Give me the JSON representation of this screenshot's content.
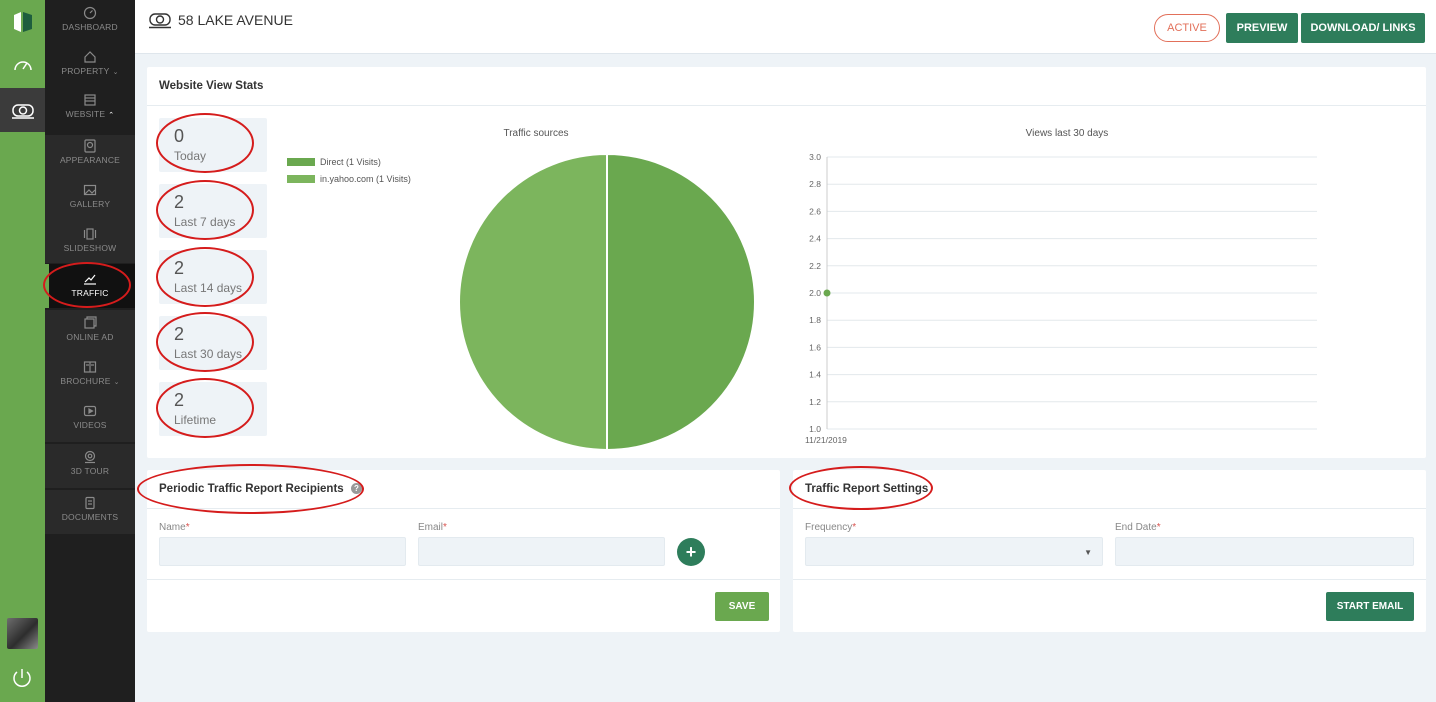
{
  "header": {
    "property_title": "58 LAKE AVENUE",
    "status_label": "ACTIVE",
    "preview_label": "PREVIEW",
    "download_label": "DOWNLOAD/ LINKS"
  },
  "sidebar": {
    "items": [
      {
        "key": "dashboard",
        "label": "DASHBOARD",
        "icon": "dashboard-icon"
      },
      {
        "key": "property",
        "label": "PROPERTY",
        "icon": "home-icon",
        "caret": "⌄"
      },
      {
        "key": "website",
        "label": "WEBSITE",
        "icon": "website-icon",
        "caret": "⌃"
      },
      {
        "key": "appearance",
        "label": "APPEARANCE",
        "icon": "appearance-icon"
      },
      {
        "key": "gallery",
        "label": "GALLERY",
        "icon": "gallery-icon"
      },
      {
        "key": "slideshow",
        "label": "SLIDESHOW",
        "icon": "slideshow-icon"
      },
      {
        "key": "traffic",
        "label": "TRAFFIC",
        "icon": "chart-icon"
      },
      {
        "key": "online_ad",
        "label": "ONLINE AD",
        "icon": "online-ad-icon"
      },
      {
        "key": "brochure",
        "label": "BROCHURE",
        "icon": "brochure-icon",
        "caret": "⌄"
      },
      {
        "key": "videos",
        "label": "VIDEOS",
        "icon": "video-icon"
      },
      {
        "key": "tour",
        "label": "3D TOUR",
        "icon": "tour-icon"
      },
      {
        "key": "documents",
        "label": "DOCUMENTS",
        "icon": "document-icon"
      }
    ]
  },
  "stats_card": {
    "title": "Website View Stats",
    "stats": [
      {
        "value": "0",
        "label": "Today"
      },
      {
        "value": "2",
        "label": "Last 7 days"
      },
      {
        "value": "2",
        "label": "Last 14 days"
      },
      {
        "value": "2",
        "label": "Last 30 days"
      },
      {
        "value": "2",
        "label": "Lifetime"
      }
    ]
  },
  "chart_data": [
    {
      "type": "pie",
      "title": "Traffic sources",
      "labels": [
        "Direct (1 Visits)",
        "in.yahoo.com (1 Visits)"
      ],
      "values": [
        1,
        1
      ],
      "colors": [
        "#6aa84f",
        "#7cb55d"
      ],
      "legend": "top-left"
    },
    {
      "type": "scatter",
      "title": "Views last 30 days",
      "x": [
        "11/21/2019"
      ],
      "y": [
        2.0
      ],
      "ylim": [
        1.0,
        3.0
      ],
      "yticks": [
        "3.0",
        "2.8",
        "2.6",
        "2.4",
        "2.2",
        "2.0",
        "1.8",
        "1.6",
        "1.4",
        "1.2",
        "1.0"
      ],
      "grid": true,
      "color": "#6aa84f"
    }
  ],
  "recipients_card": {
    "title": "Periodic Traffic Report Recipients",
    "help_icon": "?",
    "name_label": "Name",
    "email_label": "Email",
    "required_mark": "*",
    "name_value": "",
    "email_value": "",
    "add_icon": "+",
    "save_label": "SAVE"
  },
  "settings_card": {
    "title": "Traffic Report Settings",
    "frequency_label": "Frequency",
    "end_date_label": "End Date",
    "required_mark": "*",
    "frequency_value": "",
    "end_date_value": "",
    "start_label": "START EMAIL"
  },
  "colors": {
    "brand_green": "#6aa84f",
    "dark_green": "#2e7d5b",
    "active_orange": "#e2705a",
    "annotation_red": "#d51c1c"
  }
}
